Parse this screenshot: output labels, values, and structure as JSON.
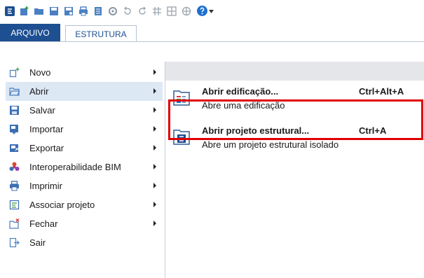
{
  "quick_access": {
    "icons": [
      "app-logo-icon",
      "new-icon",
      "open-icon",
      "save-icon",
      "save-as-icon",
      "print-icon",
      "document-icon",
      "settings-icon",
      "undo-icon",
      "redo-icon",
      "grid-icon",
      "structure-icon",
      "layout-icon",
      "help-icon",
      "dropdown-icon"
    ]
  },
  "ribbon": {
    "tabs": [
      {
        "label": "ARQUIVO",
        "active": true
      },
      {
        "label": "ESTRUTURA",
        "active": false
      }
    ]
  },
  "menu": {
    "items": [
      {
        "label": "Novo",
        "icon": "new-file-icon",
        "has_submenu": true
      },
      {
        "label": "Abrir",
        "icon": "open-folder-icon",
        "has_submenu": true,
        "selected": true
      },
      {
        "label": "Salvar",
        "icon": "save-icon",
        "has_submenu": true
      },
      {
        "label": "Importar",
        "icon": "import-icon",
        "has_submenu": true
      },
      {
        "label": "Exportar",
        "icon": "export-icon",
        "has_submenu": true
      },
      {
        "label": "Interoperabilidade BIM",
        "icon": "bim-icon",
        "has_submenu": true
      },
      {
        "label": "Imprimir",
        "icon": "print-icon",
        "has_submenu": true
      },
      {
        "label": "Associar projeto",
        "icon": "associate-icon",
        "has_submenu": true
      },
      {
        "label": "Fechar",
        "icon": "close-file-icon",
        "has_submenu": true
      },
      {
        "label": "Sair",
        "icon": "exit-icon",
        "has_submenu": false
      }
    ]
  },
  "submenu": {
    "items": [
      {
        "title": "Abrir edificação...",
        "description": "Abre uma edificação",
        "shortcut": "Ctrl+Alt+A",
        "icon": "building-folder-icon"
      },
      {
        "title": "Abrir projeto estrutural...",
        "description": "Abre um projeto estrutural isolado",
        "shortcut": "Ctrl+A",
        "icon": "structural-folder-icon",
        "highlighted": true
      }
    ]
  },
  "colors": {
    "accent": "#1d4f91",
    "highlight_border": "#e00000",
    "selection": "#dde8f5"
  }
}
